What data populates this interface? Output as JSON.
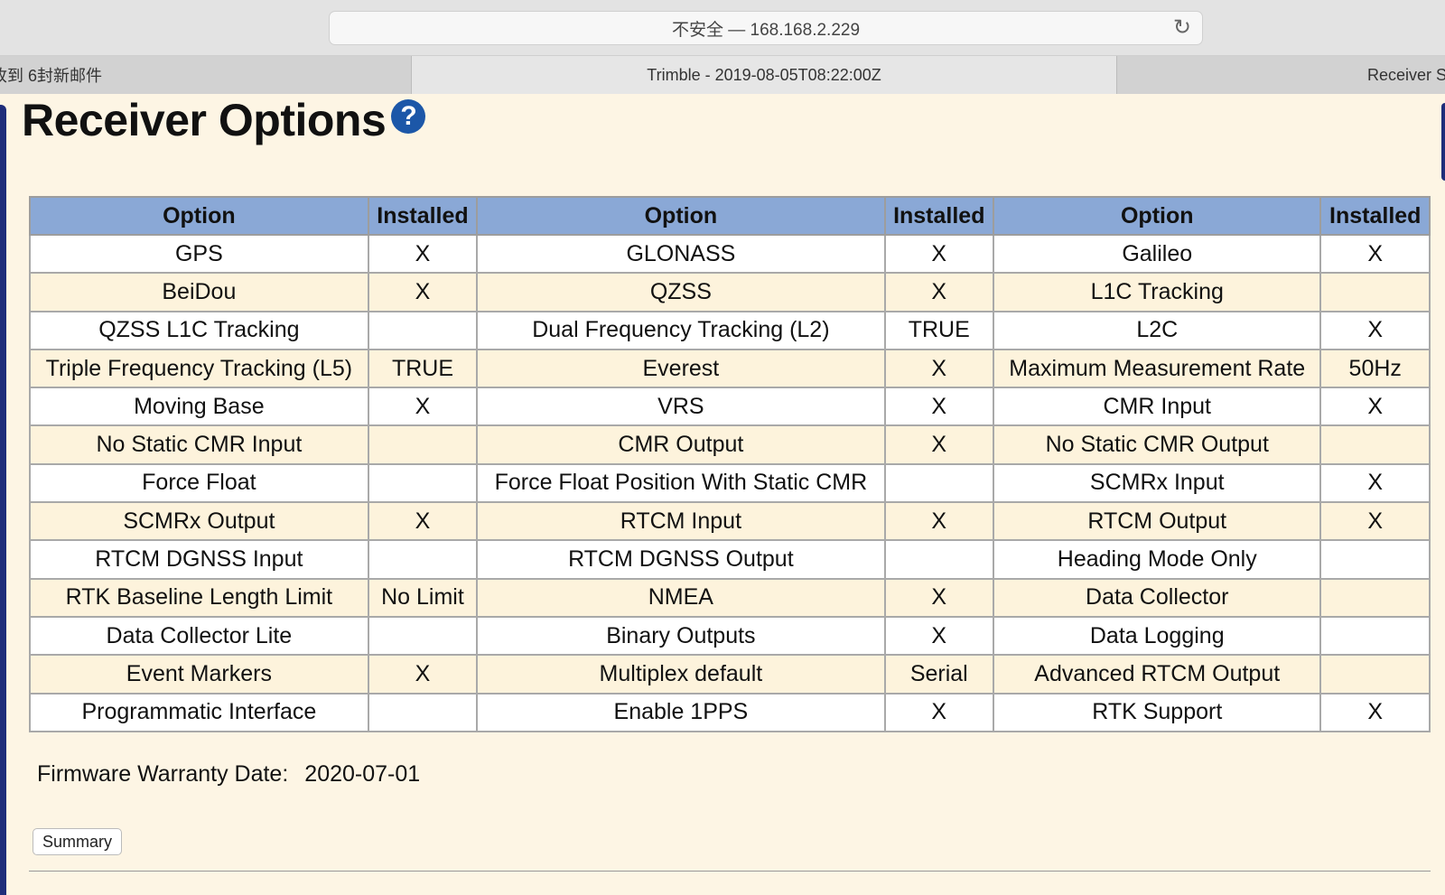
{
  "browser": {
    "url_text": "不安全 — 168.168.2.229",
    "tabs": [
      {
        "label": "收到 6封新邮件"
      },
      {
        "label": "Trimble - 2019-08-05T08:22:00Z"
      },
      {
        "label": "Receiver S"
      }
    ]
  },
  "page": {
    "title": "Receiver Options",
    "help_label": "?"
  },
  "table": {
    "headers": [
      "Option",
      "Installed",
      "Option",
      "Installed",
      "Option",
      "Installed"
    ],
    "rows": [
      [
        "GPS",
        "X",
        "GLONASS",
        "X",
        "Galileo",
        "X"
      ],
      [
        "BeiDou",
        "X",
        "QZSS",
        "X",
        "L1C Tracking",
        ""
      ],
      [
        "QZSS L1C Tracking",
        "",
        "Dual Frequency Tracking (L2)",
        "TRUE",
        "L2C",
        "X"
      ],
      [
        "Triple Frequency Tracking (L5)",
        "TRUE",
        "Everest",
        "X",
        "Maximum Measurement Rate",
        "50Hz"
      ],
      [
        "Moving Base",
        "X",
        "VRS",
        "X",
        "CMR Input",
        "X"
      ],
      [
        "No Static CMR Input",
        "",
        "CMR Output",
        "X",
        "No Static CMR Output",
        ""
      ],
      [
        "Force Float",
        "",
        "Force Float Position With Static CMR",
        "",
        "SCMRx Input",
        "X"
      ],
      [
        "SCMRx Output",
        "X",
        "RTCM Input",
        "X",
        "RTCM Output",
        "X"
      ],
      [
        "RTCM DGNSS Input",
        "",
        "RTCM DGNSS Output",
        "",
        "Heading Mode Only",
        ""
      ],
      [
        "RTK Baseline Length Limit",
        "No Limit",
        "NMEA",
        "X",
        "Data Collector",
        ""
      ],
      [
        "Data Collector Lite",
        "",
        "Binary Outputs",
        "X",
        "Data Logging",
        ""
      ],
      [
        "Event Markers",
        "X",
        "Multiplex default",
        "Serial",
        "Advanced RTCM Output",
        ""
      ],
      [
        "Programmatic Interface",
        "",
        "Enable 1PPS",
        "X",
        "RTK Support",
        "X"
      ]
    ]
  },
  "warranty": {
    "label": "Firmware Warranty Date:",
    "value": "2020-07-01"
  },
  "buttons": {
    "summary": "Summary"
  },
  "colors": {
    "header_bg": "#8aa8d6",
    "row_alt_bg": "#fdf3dc",
    "page_bg": "#fdf5e4"
  }
}
